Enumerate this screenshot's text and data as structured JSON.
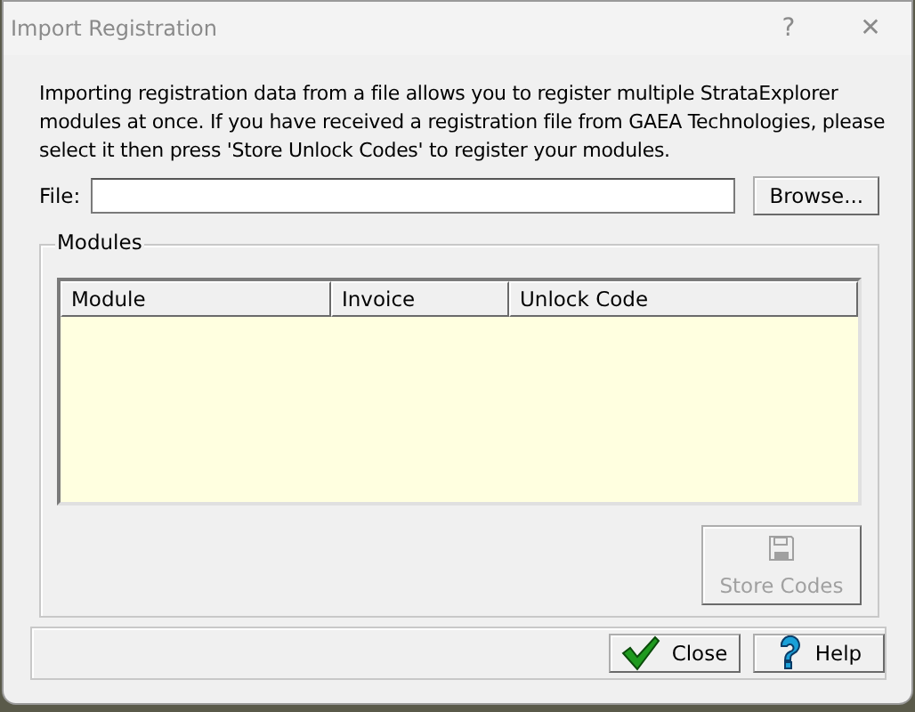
{
  "window": {
    "title": "Import Registration",
    "help_glyph": "?",
    "close_glyph": "✕"
  },
  "intro": "Importing registration data from a file allows you to register multiple StrataExplorer modules at once. If you have received a registration file from GAEA Technologies, please select it then press 'Store Unlock Codes' to register your modules.",
  "file": {
    "label": "File:",
    "browse": "Browse..."
  },
  "modules": {
    "title": "Modules",
    "columns": [
      "Module",
      "Invoice",
      "Unlock Code"
    ],
    "store_button": {
      "label": "Store Codes",
      "disabled": true
    }
  },
  "buttons": [
    {
      "label": "Close",
      "kind": "close"
    },
    {
      "label": "Help",
      "kind": "help"
    }
  ]
}
